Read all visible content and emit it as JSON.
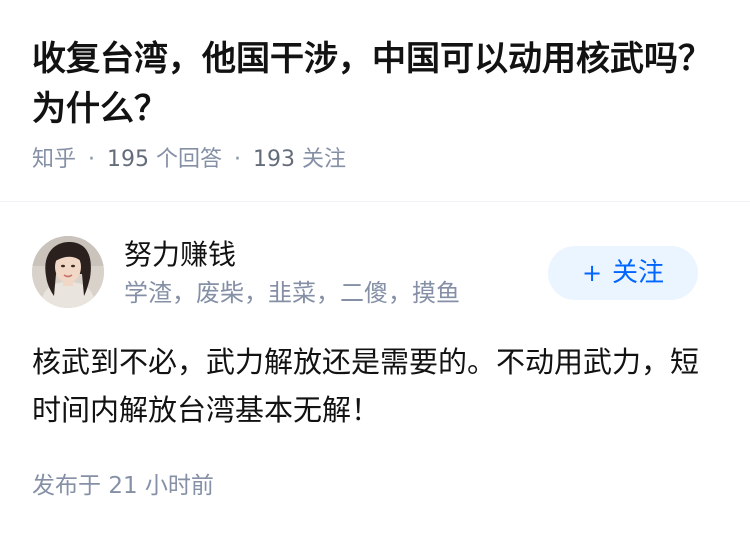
{
  "question": {
    "title": "收复台湾，他国干涉，中国可以动用核武吗？为什么？",
    "source": "知乎",
    "answer_count": "195",
    "answer_label": "个回答",
    "follower_count": "193",
    "follower_label": "关注",
    "separator": "·"
  },
  "author": {
    "name": "努力赚钱",
    "bio": "学渣，废柴，韭菜，二傻，摸鱼",
    "follow_icon": "+",
    "follow_label": "关注"
  },
  "answer": {
    "content": "核武到不必，武力解放还是需要的。不动用武力，短时间内解放台湾基本无解！",
    "publish_label": "发布于",
    "publish_time": "21 小时前"
  },
  "colors": {
    "accent": "#0066ff",
    "follow_bg": "#ebf5ff",
    "meta_text": "#8590a6",
    "primary_text": "#121212"
  },
  "icons": {
    "avatar": "avatar-portrait"
  }
}
